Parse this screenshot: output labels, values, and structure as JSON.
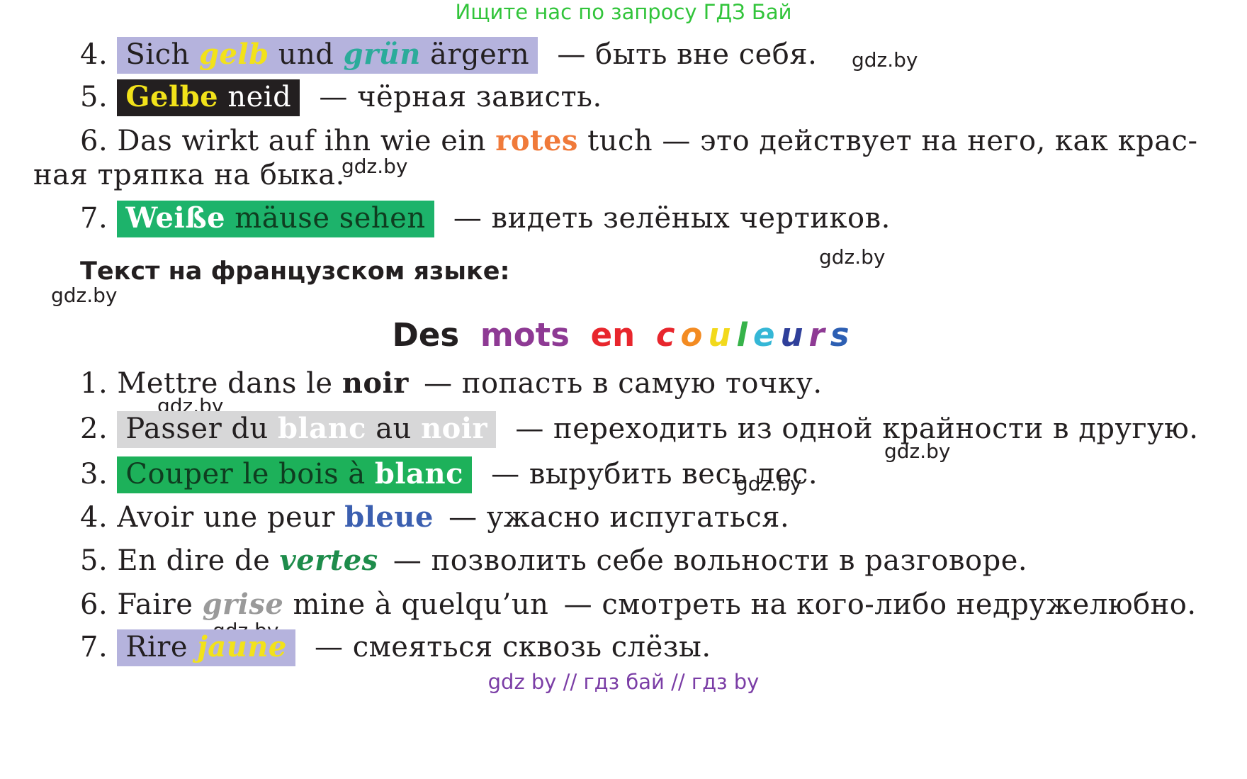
{
  "banner": "Ищите нас по запросу ГДЗ Бай",
  "watermark": "gdz.by",
  "footer": "gdz by  //  гдз бай  //  гдз by",
  "colors": {
    "banner": "#31c43a",
    "yellow": "#f2e21a",
    "teal": "#2bab9a",
    "red_orange": "#f07a3a",
    "blue": "#3b5fb0",
    "green": "#1e8c4b",
    "grey": "#9a9a9a",
    "footer": "#7b3ea6"
  },
  "german": [
    {
      "num": "4.",
      "parts": [
        "Sich ",
        "gelb",
        " und ",
        "grün",
        " ärgern"
      ],
      "translation": "— быть вне себя."
    },
    {
      "num": "5.",
      "parts": [
        "Gelbe",
        " neid"
      ],
      "translation": "— чёрная зависть."
    },
    {
      "num": "6.",
      "parts": [
        "Das wirkt auf ihn wie ein ",
        "rotes",
        " tuch"
      ],
      "translation": "— это действует на него, как крас-",
      "translation_cont": "ная тряпка на быка."
    },
    {
      "num": "7.",
      "parts": [
        "Weiße",
        " mäuse sehen"
      ],
      "translation": "— видеть зелёных чертиков."
    }
  ],
  "section_label": "Текст на французском языке:",
  "title": {
    "w1": "Des",
    "w2": "mots",
    "w3": "en",
    "letters": [
      "c",
      "o",
      "u",
      "l",
      "e",
      "u",
      "r",
      "s"
    ],
    "letter_colors": [
      "#e8262d",
      "#f38b22",
      "#f2d91c",
      "#37b34a",
      "#35b7d6",
      "#2f3f9a",
      "#8e3a94",
      "#2d5fb3"
    ]
  },
  "french": [
    {
      "num": "1.",
      "parts": [
        "Mettre dans le ",
        "noir"
      ],
      "translation": "— попасть в самую точку."
    },
    {
      "num": "2.",
      "parts": [
        "Passer du ",
        "blanc",
        " au ",
        "noir"
      ],
      "translation": "— переходить из одной крайности в другую."
    },
    {
      "num": "3.",
      "parts": [
        "Couper le bois à ",
        "blanc"
      ],
      "translation": "— вырубить весь лес."
    },
    {
      "num": "4.",
      "parts": [
        "Avoir une peur ",
        "bleue"
      ],
      "translation": "— ужасно испугаться."
    },
    {
      "num": "5.",
      "parts": [
        "En dire de ",
        "vertes"
      ],
      "translation": "— позволить себе вольности в разговоре."
    },
    {
      "num": "6.",
      "parts": [
        "Faire ",
        "grise",
        " mine à quelqu’un"
      ],
      "translation": "— смотреть на кого-либо недружелюбно."
    },
    {
      "num": "7.",
      "parts": [
        "Rire ",
        "jaune"
      ],
      "translation": "— смеяться сквозь слёзы."
    }
  ]
}
